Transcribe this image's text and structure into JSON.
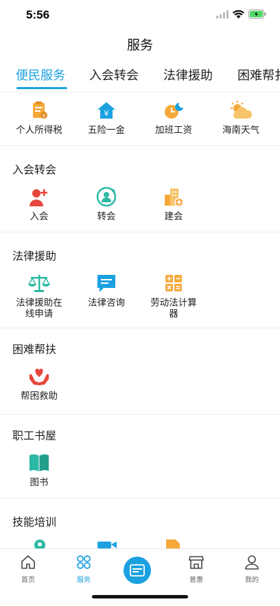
{
  "status": {
    "time": "5:56"
  },
  "header": {
    "title": "服务"
  },
  "tabs": [
    "便民服务",
    "入会转会",
    "法律援助",
    "困难帮扌"
  ],
  "convenience": [
    {
      "label": "个人所得税",
      "icon": "tax-document-icon"
    },
    {
      "label": "五险一金",
      "icon": "yuan-house-icon"
    },
    {
      "label": "加班工资",
      "icon": "overtime-clock-icon"
    },
    {
      "label": "海南天气",
      "icon": "weather-icon"
    }
  ],
  "sections": [
    {
      "title": "入会转会",
      "items": [
        {
          "label": "入会",
          "icon": "add-user-icon"
        },
        {
          "label": "转会",
          "icon": "transfer-user-icon"
        },
        {
          "label": "建会",
          "icon": "build-union-icon"
        }
      ]
    },
    {
      "title": "法律援助",
      "items": [
        {
          "label": "法律援助在线申请",
          "icon": "scale-icon"
        },
        {
          "label": "法律咨询",
          "icon": "chat-icon"
        },
        {
          "label": "劳动法计算器",
          "icon": "calculator-icon"
        }
      ]
    },
    {
      "title": "困难帮扶",
      "items": [
        {
          "label": "帮困救助",
          "icon": "heart-hands-icon"
        }
      ]
    },
    {
      "title": "职工书屋",
      "items": [
        {
          "label": "图书",
          "icon": "book-icon"
        }
      ]
    },
    {
      "title": "技能培训",
      "items": []
    }
  ],
  "tabbar": [
    {
      "label": "首页",
      "icon": "home-icon"
    },
    {
      "label": "服务",
      "icon": "service-icon"
    },
    {
      "label": "",
      "icon": "card-icon"
    },
    {
      "label": "普惠",
      "icon": "shop-icon"
    },
    {
      "label": "我的",
      "icon": "user-icon"
    }
  ],
  "colors": {
    "accent": "#1ba1e0",
    "orange": "#f5a83a",
    "red": "#e8463c",
    "teal": "#2bb8a4"
  }
}
